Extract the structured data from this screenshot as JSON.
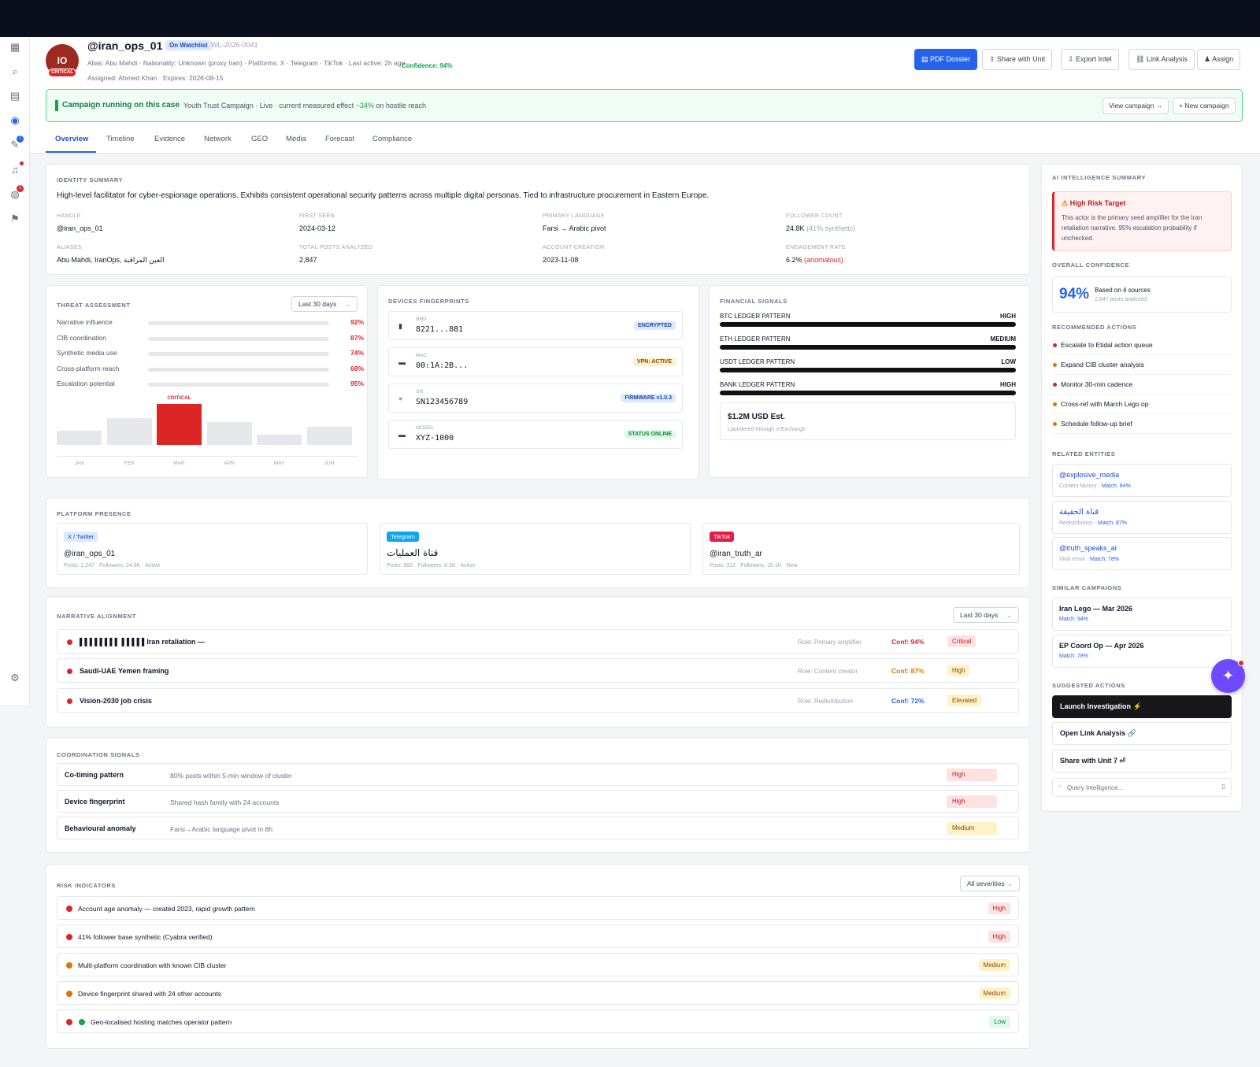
{
  "rail": {
    "badges": [
      "7",
      "1"
    ]
  },
  "profile": {
    "initials": "IO",
    "severity": "CRITICAL",
    "handle": "@iran_ops_01",
    "watchlist_tag": "On Watchlist",
    "watchlist_id": "WL-2026-0041",
    "meta_line": "Alias: Abu Mahdi · Nationality: Unknown (proxy Iran) · Platforms: X · Telegram · TikTok · Last active: 2h ago ·",
    "confidence": "Confidence: 94%",
    "assigned_line": "Assigned: Ahmed Khan · Expires: 2026-08-15"
  },
  "actions": {
    "pdf": "PDF Dossier",
    "share": "Share with Unit",
    "export": "Export Intel",
    "link": "Link Analysis",
    "assign": "Assign"
  },
  "campaign": {
    "title": "Campaign running on this case",
    "subtitle_pre": "Youth Trust Campaign · Live · current measured effect ",
    "effect": "−34%",
    "subtitle_post": " on hostile reach",
    "view": "View campaign →",
    "new": "+ New campaign"
  },
  "tabs": [
    "Overview",
    "Timeline",
    "Evidence",
    "Network",
    "GEO",
    "Media",
    "Forecast",
    "Compliance"
  ],
  "identity": {
    "title": "IDENTITY SUMMARY",
    "summary": "High-level facilitator for cyber-espionage operations. Exhibits consistent operational security patterns across multiple digital personas. Tied to infrastructure procurement in Eastern Europe.",
    "fields": [
      {
        "label": "HANDLE",
        "value": "@iran_ops_01"
      },
      {
        "label": "FIRST SEEN",
        "value": "2024-03-12"
      },
      {
        "label": "PRIMARY LANGUAGE",
        "value": "Farsi → Arabic pivot"
      },
      {
        "label": "FOLLOWER COUNT",
        "value": "24.8K",
        "note": "(41% synthetic)"
      },
      {
        "label": "ALIASES",
        "value": "Abu Mahdi, IranOps, العين المراقبة"
      },
      {
        "label": "TOTAL POSTS ANALYZED",
        "value": "2,847"
      },
      {
        "label": "ACCOUNT CREATION",
        "value": "2023-11-08"
      },
      {
        "label": "ENGAGEMENT RATE",
        "value": "6.2%",
        "note": "(anomalous)"
      }
    ]
  },
  "threat": {
    "title": "THREAT ASSESSMENT",
    "range": "Last 30 days",
    "rows": [
      {
        "name": "Narrative influence",
        "pct": "92%"
      },
      {
        "name": "CIB coordination",
        "pct": "87%"
      },
      {
        "name": "Synthetic media use",
        "pct": "74%"
      },
      {
        "name": "Cross-platform reach",
        "pct": "68%"
      },
      {
        "name": "Escalation potential",
        "pct": "95%"
      }
    ],
    "critical_label": "CRITICAL",
    "months": [
      {
        "m": "JAN",
        "v": 0.35
      },
      {
        "m": "FEB",
        "v": 0.65
      },
      {
        "m": "MAR",
        "v": 1.0
      },
      {
        "m": "APR",
        "v": 0.56
      },
      {
        "m": "MAY",
        "v": 0.25
      },
      {
        "m": "JUN",
        "v": 0.45
      }
    ]
  },
  "devices": {
    "title": "DEVICES FINGERPRINTS",
    "items": [
      {
        "key": "IMEI",
        "value": "8221...881",
        "tag": "ENCRYPTED",
        "icon": "phone-icon"
      },
      {
        "key": "MAC",
        "value": "00:1A:2B...",
        "tag": "VPN: ACTIVE",
        "icon": "laptop-icon"
      },
      {
        "key": "SN",
        "value": "SN123456789",
        "tag": "FIRMWARE v1.0.3",
        "icon": "chip-icon"
      },
      {
        "key": "MODEL",
        "value": "XYZ-1000",
        "tag": "STATUS ONLINE",
        "icon": "monitor-icon"
      }
    ]
  },
  "financial": {
    "title": "FINANCIAL SIGNALS",
    "rows": [
      {
        "name": "BTC LEDGER PATTERN",
        "level": "HIGH"
      },
      {
        "name": "ETH LEDGER PATTERN",
        "level": "MEDIUM"
      },
      {
        "name": "USDT LEDGER PATTERN",
        "level": "LOW"
      },
      {
        "name": "BANK LEDGER PATTERN",
        "level": "HIGH"
      }
    ],
    "total": "$1.2M USD Est.",
    "total_note": "Laundered through V-Exchange"
  },
  "platforms": {
    "title": "PLATFORM PRESENCE",
    "items": [
      {
        "tag": "X / Twitter",
        "handle": "@iran_ops_01",
        "stats": "Posts: 1,247 · Followers: 24.8K · Active"
      },
      {
        "tag": "Telegram",
        "handle": "قناة العمليات",
        "stats": "Posts: 892 · Followers: 8.2K · Active"
      },
      {
        "tag": "TikTok",
        "handle": "@iran_truth_ar",
        "stats": "Posts: 312 · Followers: 15.1K · New"
      }
    ]
  },
  "narrative": {
    "title": "NARRATIVE ALIGNMENT",
    "range": "Last 30 days",
    "rows": [
      {
        "text": "▌▌▌▌▌▌▌▌ ▌▌▌▌▌Iran retaliation —",
        "role": "Role: Primary amplifier",
        "conf": "Conf: 94%",
        "sev": "Critical"
      },
      {
        "text": "Saudi-UAE Yemen framing",
        "role": "Role: Content creator",
        "conf": "Conf: 87%",
        "sev": "High"
      },
      {
        "text": "Vision-2030 job crisis",
        "role": "Role: Redistribution",
        "conf": "Conf: 72%",
        "sev": "Elevated"
      }
    ]
  },
  "coordination": {
    "title": "COORDINATION SIGNALS",
    "rows": [
      {
        "name": "Co-timing pattern",
        "desc": "80% posts within 5-min window of cluster",
        "sev": "High"
      },
      {
        "name": "Device fingerprint",
        "desc": "Shared hash family with 24 accounts",
        "sev": "High"
      },
      {
        "name": "Behavioural anomaly",
        "desc": "Farsi→Arabic language pivot in 8h",
        "sev": "Medium"
      }
    ]
  },
  "risk": {
    "title": "RISK INDICATORS",
    "filter": "All severities",
    "rows": [
      {
        "text": "Account age anomaly — created 2023, rapid growth pattern",
        "sev": "High"
      },
      {
        "text": "41% follower base synthetic (Cyabra verified)",
        "sev": "High"
      },
      {
        "text": "Multi-platform coordination with known CIB cluster",
        "sev": "Medium"
      },
      {
        "text": "Device fingerprint shared with 24 other accounts",
        "sev": "Medium"
      },
      {
        "text": "Geo-localised hosting matches operator pattern",
        "sev": "Low"
      }
    ]
  },
  "ai": {
    "title": "AI INTELLIGENCE SUMMARY",
    "alert_title": "High Risk Target",
    "alert_body": "This actor is the primary seed amplifier for the Iran retaliation narrative. 95% escalation probability if unchecked.",
    "conf_title": "OVERALL CONFIDENCE",
    "conf_value": "94%",
    "conf_basis": "Based on 4 sources",
    "conf_posts": "2,847 posts analyzed",
    "rec_title": "RECOMMENDED ACTIONS",
    "recs": [
      {
        "text": "Escalate to Etidal action queue",
        "color": "#dc2626"
      },
      {
        "text": "Expand CIB cluster analysis",
        "color": "#d97706"
      },
      {
        "text": "Monitor 30-min cadence",
        "color": "#dc2626"
      },
      {
        "text": "Cross-ref with March Lego op",
        "color": "#d97706"
      },
      {
        "text": "Schedule follow-up brief",
        "color": "#d97706"
      }
    ],
    "rel_title": "RELATED ENTITIES",
    "related": [
      {
        "name": "@explosive_media",
        "kind": "Content factory · ",
        "match": "Match: 94%"
      },
      {
        "name": "قناة الحقيقة",
        "kind": "Redistribution · ",
        "match": "Match: 87%"
      },
      {
        "name": "@truth_speaks_ar",
        "kind": "Viral remix · ",
        "match": "Match: 78%"
      }
    ],
    "sim_title": "SIMILAR CAMPAIGNS",
    "similar": [
      {
        "name": "Iran Lego — Mar 2026",
        "match": "Match: 94%"
      },
      {
        "name": "EP Coord Op — Apr 2026",
        "match": "Match: 78%"
      }
    ],
    "sug_title": "SUGGESTED ACTIONS",
    "launch": "Launch Investigation ⚡",
    "open_link": "Open Link Analysis 🔗",
    "share_unit": "Share with Unit 7 ⏎",
    "query_placeholder": "Query Intelligence..."
  }
}
